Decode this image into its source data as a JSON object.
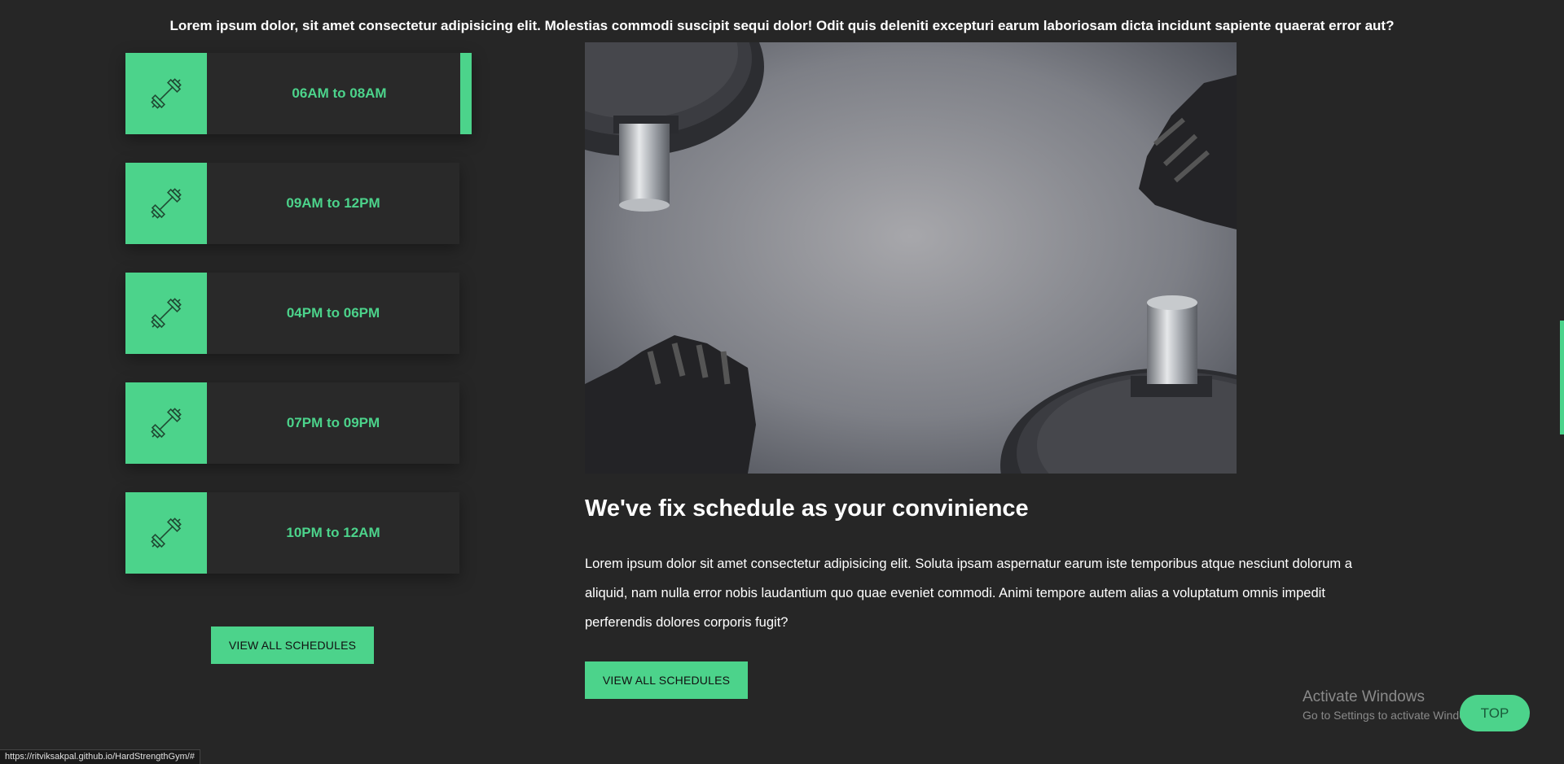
{
  "intro_text": "Lorem ipsum dolor, sit amet consectetur adipisicing elit. Molestias commodi suscipit sequi dolor! Odit quis deleniti excepturi earum laboriosam dicta incidunt sapiente quaerat error aut?",
  "schedule": {
    "items": [
      {
        "time": "06AM to 08AM",
        "icon": "dumbbell-icon"
      },
      {
        "time": "09AM to 12PM",
        "icon": "dumbbell-icon"
      },
      {
        "time": "04PM to 06PM",
        "icon": "dumbbell-icon"
      },
      {
        "time": "07PM to 09PM",
        "icon": "dumbbell-icon"
      },
      {
        "time": "10PM to 12AM",
        "icon": "dumbbell-icon"
      }
    ],
    "button_label": "VIEW ALL SCHEDULES"
  },
  "main": {
    "heading": "We've fix schedule as your convinience",
    "paragraph": "Lorem ipsum dolor sit amet consectetur adipisicing elit. Soluta ipsam aspernatur earum iste temporibus atque nesciunt dolorum a aliquid, nam nulla error nobis laudantium quo quae eveniet commodi. Animi tempore autem alias a voluptatum omnis impedit perferendis dolores corporis fugit?",
    "button_label": "VIEW ALL SCHEDULES"
  },
  "watermark": {
    "line1": "Activate Windows",
    "line2": "Go to Settings to activate Windows."
  },
  "top_button": "TOP",
  "status_url": "https://ritviksakpal.github.io/HardStrengthGym/#",
  "colors": {
    "accent": "#4cd38b",
    "background": "#262626",
    "card": "#292929"
  }
}
